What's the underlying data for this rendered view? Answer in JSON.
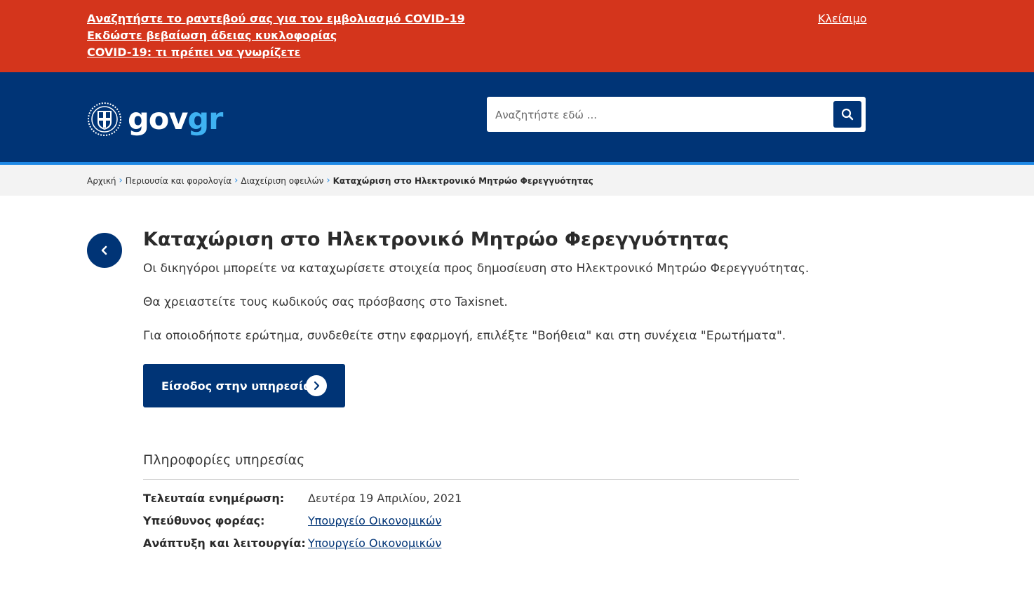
{
  "banner": {
    "links": [
      "Αναζητήστε το ραντεβού σας για τον εμβολιασμό COVID-19",
      "Εκδώστε βεβαίωση άδειας κυκλοφορίας",
      "COVID-19: τι πρέπει να γνωρίζετε"
    ],
    "close_label": "Κλείσιμο"
  },
  "header": {
    "logo_gov": "gov",
    "logo_gr": "gr",
    "search_placeholder": "Αναζητήστε εδώ ...",
    "search_icon": "search-icon"
  },
  "breadcrumb": {
    "items": [
      "Αρχική",
      "Περιουσία και φορολογία",
      "Διαχείριση οφειλών"
    ],
    "current": "Καταχώριση στο Ηλεκτρονικό Μητρώο Φερεγγυότητας"
  },
  "main": {
    "title": "Καταχώριση στο Ηλεκτρονικό Μητρώο Φερεγγυότητας",
    "paragraphs": [
      "Οι δικηγόροι μπορείτε να καταχωρίσετε στοιχεία προς δημοσίευση στο Ηλεκτρονικό Μητρώο Φερεγγυότητας.",
      "Θα χρειαστείτε τους κωδικούς σας πρόσβασης στο Taxisnet.",
      "Για οποιοδήποτε ερώτημα, συνδεθείτε στην εφαρμογή, επιλέξτε \"Βοήθεια\" και στη συνέχεια \"Ερωτήματα\"."
    ],
    "cta_label": "Είσοδος στην υπηρεσία"
  },
  "info": {
    "title": "Πληροφορίες υπηρεσίας",
    "rows": [
      {
        "label": "Τελευταία ενημέρωση",
        "value": "Δευτέρα 19 Απριλίου, 2021"
      },
      {
        "label": "Υπεύθυνος φορέας",
        "value": "Υπουργείο Οικονομικών"
      },
      {
        "label": "Ανάπτυξη και λειτουργία",
        "value": "Υπουργείο Οικονομικών"
      }
    ]
  },
  "colors": {
    "banner_bg": "#d4351c",
    "header_bg": "#003476",
    "accent": "#3fb2f2",
    "stripe": "#1e88e5"
  }
}
